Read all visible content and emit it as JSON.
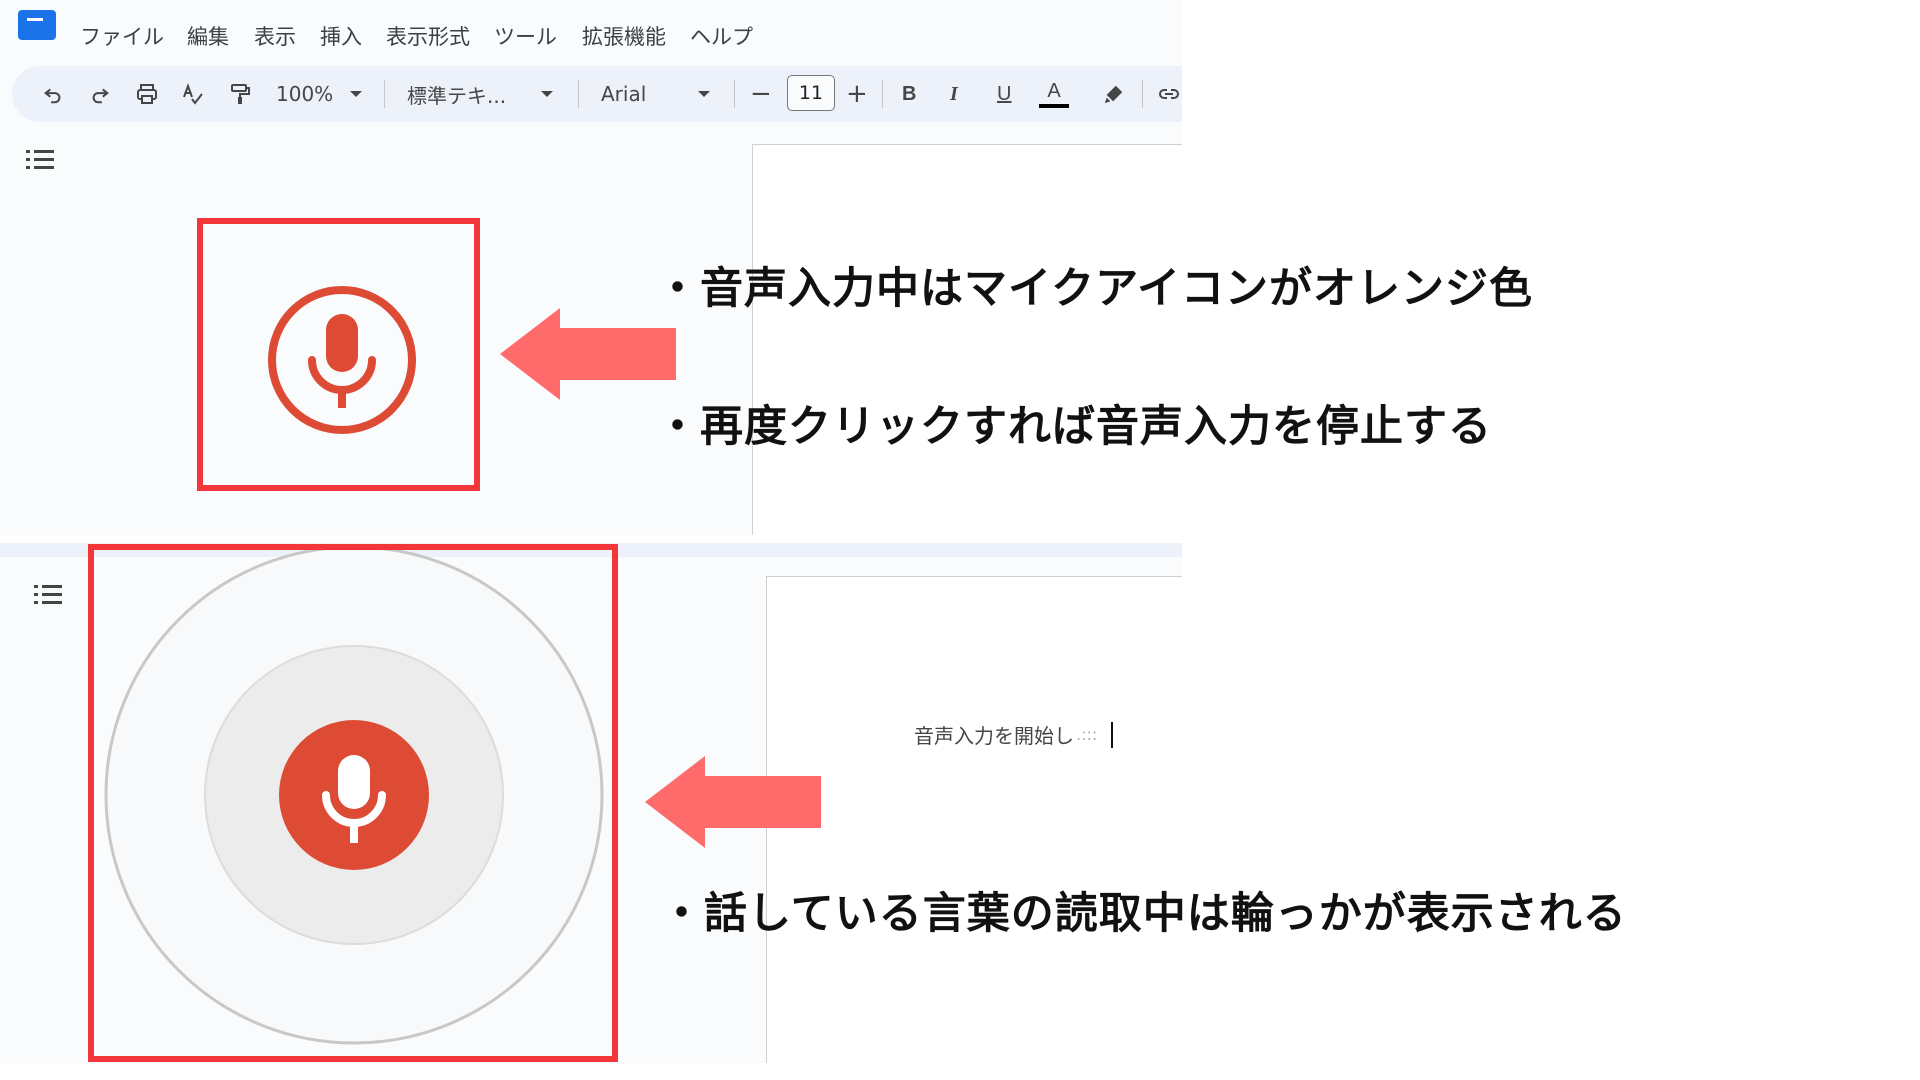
{
  "menu": {
    "items": [
      "ファイル",
      "編集",
      "表示",
      "挿入",
      "表示形式",
      "ツール",
      "拡張機能",
      "ヘルプ"
    ]
  },
  "toolbar": {
    "zoom": "100%",
    "style": "標準テキ...",
    "font": "Arial",
    "font_size": "11",
    "decrease_label": "−",
    "increase_label": "+",
    "bold_label": "B",
    "italic_label": "I",
    "underline_label": "U",
    "text_color_label": "A",
    "text_color": "#000000"
  },
  "document": {
    "dictation_text": "音声入力を開始し"
  },
  "annotations": {
    "line1": "・音声入力中はマイクアイコンがオレンジ色",
    "line2": "・再度クリックすれば音声入力を停止する",
    "line3": "・話している言葉の読取中は輪っかが表示される"
  },
  "colors": {
    "mic_active": "#dd4b34",
    "highlight_box": "#f2363a",
    "arrow": "#ff6b6b",
    "toolbar_bg": "#edf2fa",
    "canvas_bg": "#f9fbfd"
  },
  "icons": {
    "undo": "undo-icon",
    "redo": "redo-icon",
    "print": "print-icon",
    "spellcheck": "spellcheck-icon",
    "paint_format": "paint-format-icon",
    "highlighter": "highlighter-icon",
    "link": "link-icon",
    "outline": "outline-list-icon",
    "mic": "microphone-icon"
  }
}
